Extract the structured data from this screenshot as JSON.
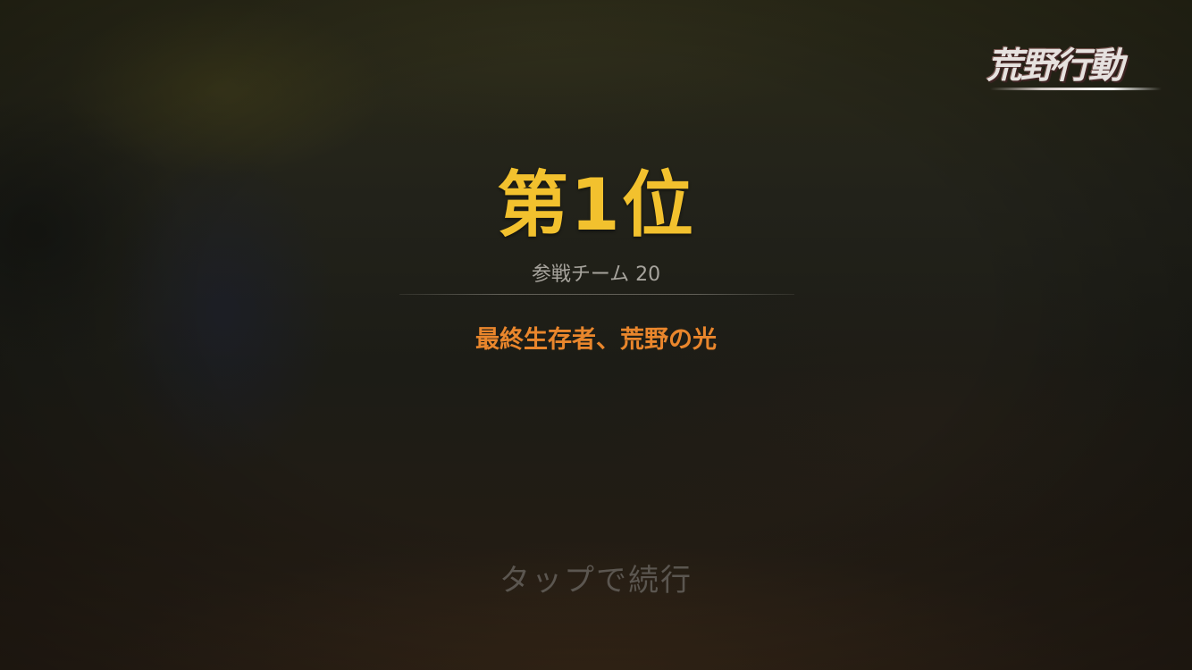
{
  "logo": {
    "text": "荒野行動"
  },
  "result": {
    "rank": "第1位",
    "teams": "参戦チーム 20",
    "subtitle": "最終生存者、荒野の光"
  },
  "prompt": {
    "tap_label": "タップで続行"
  },
  "colors": {
    "rank": "#f2c12e",
    "subtitle": "#e9862c",
    "teams": "#a7a49d",
    "tap": "#5b5650"
  }
}
